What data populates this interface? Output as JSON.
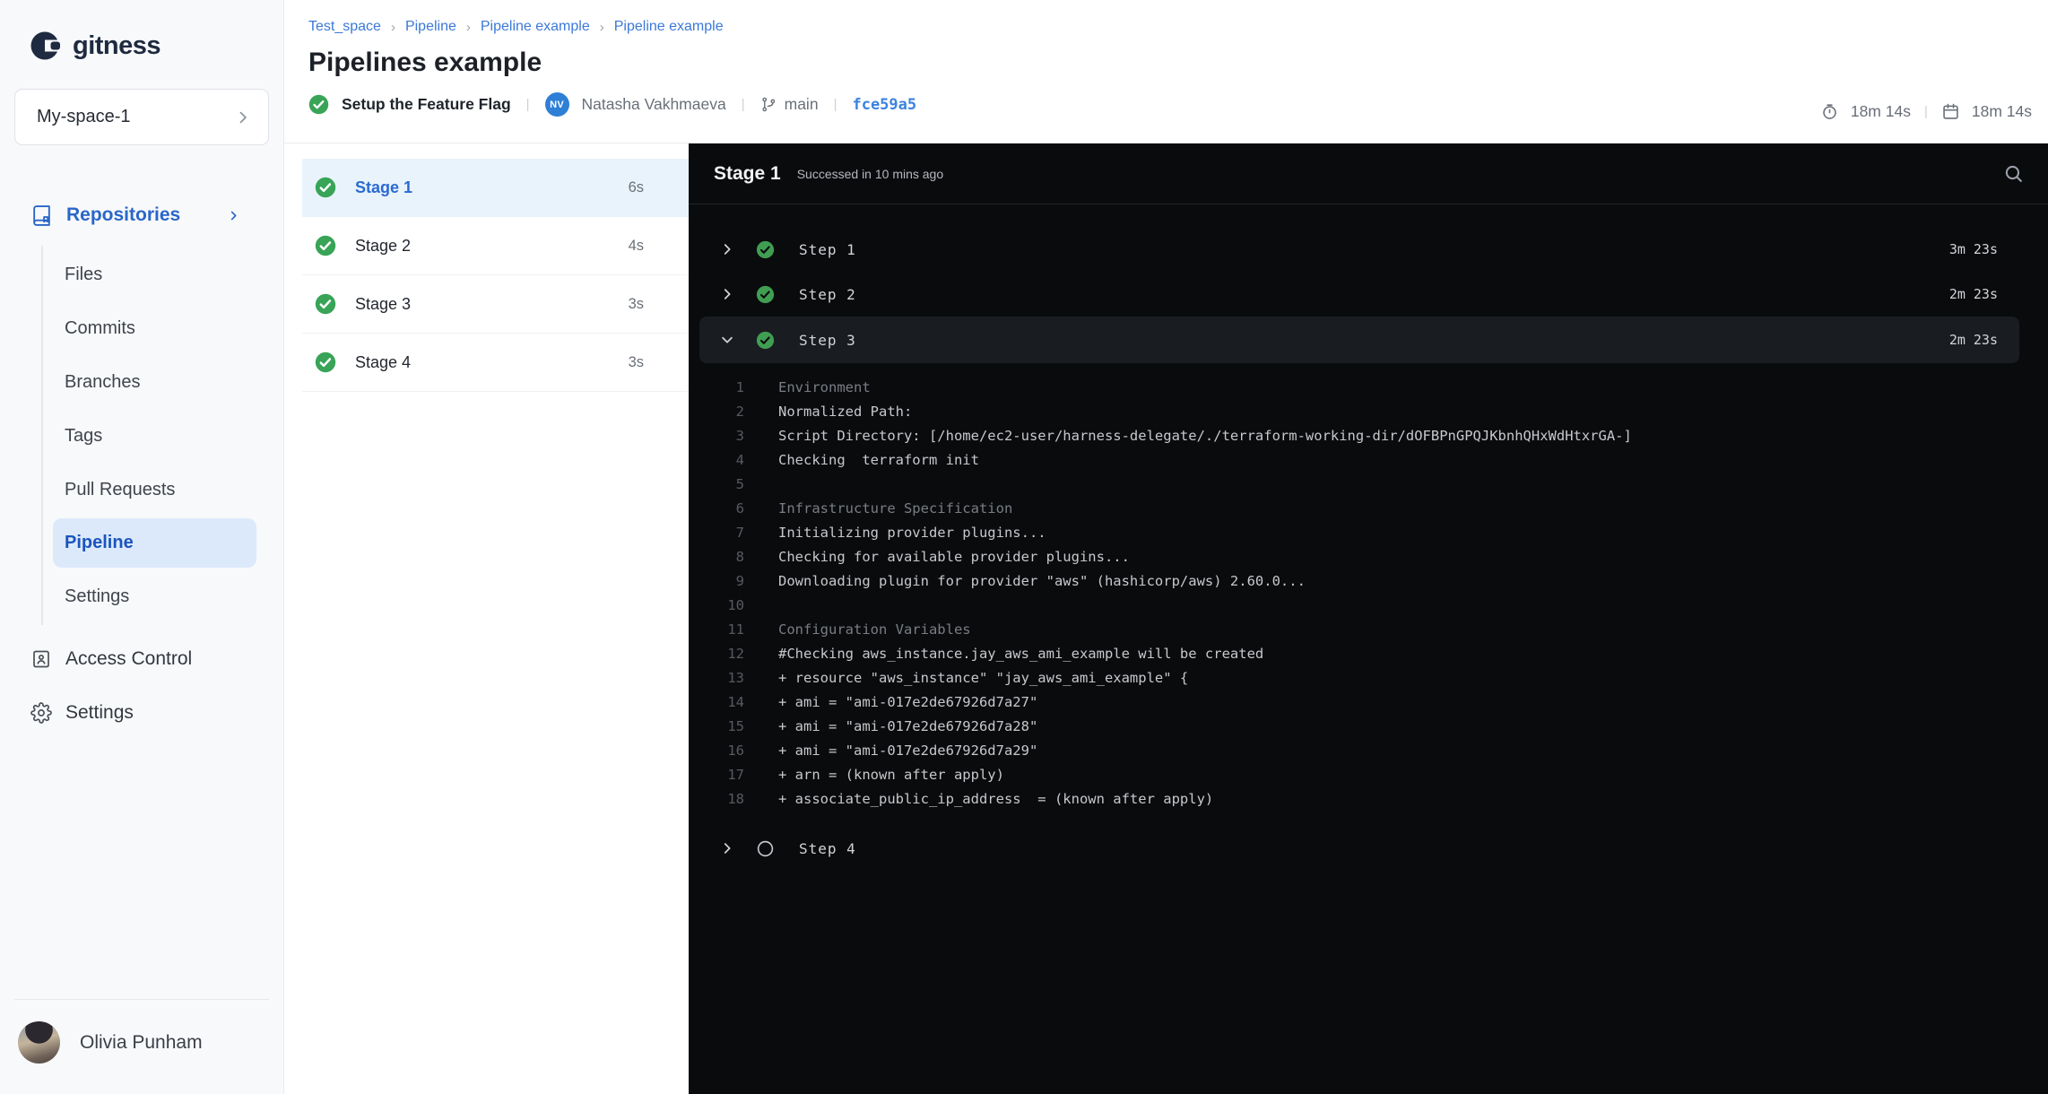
{
  "brand": {
    "name": "gitness"
  },
  "sidebar": {
    "space_selector": "My-space-1",
    "repositories": {
      "label": "Repositories"
    },
    "repo_items": [
      {
        "label": "Files",
        "selected": false
      },
      {
        "label": "Commits",
        "selected": false
      },
      {
        "label": "Branches",
        "selected": false
      },
      {
        "label": "Tags",
        "selected": false
      },
      {
        "label": "Pull Requests",
        "selected": false
      },
      {
        "label": "Pipeline",
        "selected": true
      },
      {
        "label": "Settings",
        "selected": false
      }
    ],
    "access_control": "Access Control",
    "settings": "Settings",
    "user_name": "Olivia Punham"
  },
  "breadcrumb": [
    "Test_space",
    "Pipeline",
    "Pipeline example",
    "Pipeline example"
  ],
  "header": {
    "title": "Pipelines example",
    "commit_message": "Setup the Feature Flag",
    "author_initials": "NV",
    "author_name": "Natasha Vakhmaeva",
    "branch": "main",
    "commit_sha": "fce59a5",
    "elapsed_time": "18m 14s",
    "finished_time": "18m 14s"
  },
  "stages": [
    {
      "name": "Stage 1",
      "duration": "6s",
      "status": "success",
      "selected": true
    },
    {
      "name": "Stage 2",
      "duration": "4s",
      "status": "success",
      "selected": false
    },
    {
      "name": "Stage 3",
      "duration": "3s",
      "status": "success",
      "selected": false
    },
    {
      "name": "Stage 4",
      "duration": "3s",
      "status": "success",
      "selected": false
    }
  ],
  "console": {
    "stage_title": "Stage 1",
    "status_text": "Successed in 10 mins ago",
    "steps": [
      {
        "name": "Step 1",
        "duration": "3m 23s",
        "status": "success",
        "expanded": false
      },
      {
        "name": "Step 2",
        "duration": "2m 23s",
        "status": "success",
        "expanded": false
      },
      {
        "name": "Step 3",
        "duration": "2m 23s",
        "status": "success",
        "expanded": true
      },
      {
        "name": "Step 4",
        "duration": "",
        "status": "pending",
        "expanded": false
      }
    ],
    "log_lines": [
      {
        "n": 1,
        "text": "Environment",
        "kind": "section"
      },
      {
        "n": 2,
        "text": "Normalized Path:",
        "kind": "normal"
      },
      {
        "n": 3,
        "text": "Script Directory: [/home/ec2-user/harness-delegate/./terraform-working-dir/dOFBPnGPQJKbnhQHxWdHtxrGA-]",
        "kind": "normal"
      },
      {
        "n": 4,
        "text": "Checking  terraform init",
        "kind": "normal"
      },
      {
        "n": 5,
        "text": "",
        "kind": "normal"
      },
      {
        "n": 6,
        "text": "Infrastructure Specification",
        "kind": "section"
      },
      {
        "n": 7,
        "text": "Initializing provider plugins...",
        "kind": "normal"
      },
      {
        "n": 8,
        "text": "Checking for available provider plugins...",
        "kind": "normal"
      },
      {
        "n": 9,
        "text": "Downloading plugin for provider \"aws\" (hashicorp/aws) 2.60.0...",
        "kind": "normal"
      },
      {
        "n": 10,
        "text": "",
        "kind": "normal"
      },
      {
        "n": 11,
        "text": "Configuration Variables",
        "kind": "section"
      },
      {
        "n": 12,
        "text": "#Checking aws_instance.jay_aws_ami_example will be created",
        "kind": "normal"
      },
      {
        "n": 13,
        "text": "+ resource \"aws_instance\" \"jay_aws_ami_example\" {",
        "kind": "normal"
      },
      {
        "n": 14,
        "text": "+ ami = \"ami-017e2de67926d7a27\"",
        "kind": "normal"
      },
      {
        "n": 15,
        "text": "+ ami = \"ami-017e2de67926d7a28\"",
        "kind": "normal"
      },
      {
        "n": 16,
        "text": "+ ami = \"ami-017e2de67926d7a29\"",
        "kind": "normal"
      },
      {
        "n": 17,
        "text": "+ arn = (known after apply)",
        "kind": "normal"
      },
      {
        "n": 18,
        "text": "+ associate_public_ip_address  = (known after apply)",
        "kind": "normal"
      }
    ]
  },
  "icons": {
    "success": "check-circle",
    "pending": "empty-circle",
    "elapsed": "stopwatch",
    "finished": "calendar",
    "search": "magnifier",
    "branch": "git-branch"
  },
  "colors": {
    "accent_blue": "#2a66c9",
    "link_blue": "#3b79d8",
    "sha_blue": "#3b82e0",
    "success_green": "#38a457",
    "console_bg": "#0a0b0d",
    "step_highlight": "#191c21",
    "selected_stage_bg": "#e9f3fb",
    "selected_nav_bg": "#dce9fb",
    "sidebar_bg": "#f8f9fb"
  }
}
